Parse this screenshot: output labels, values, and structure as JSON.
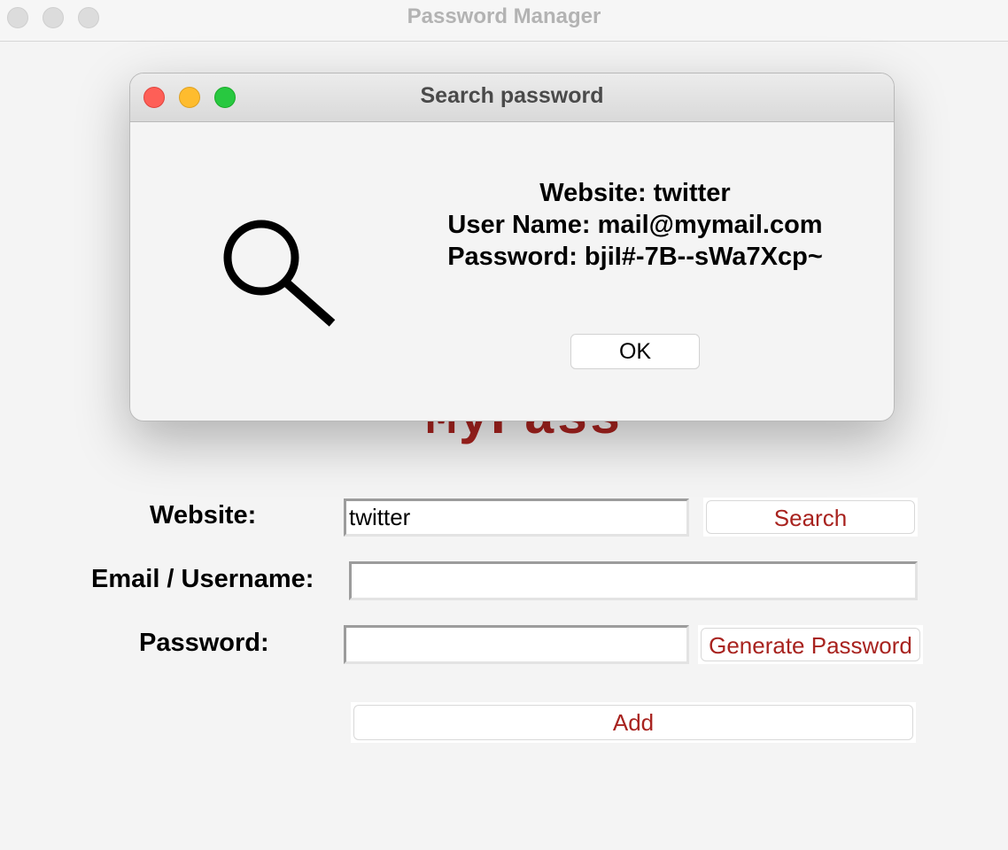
{
  "window": {
    "title": "Password Manager"
  },
  "logo": {
    "text": "MyPass",
    "color": "#a8231f"
  },
  "form": {
    "website_label": "Website:",
    "website_value": "twitter",
    "email_label": "Email / Username:",
    "email_value": "",
    "password_label": "Password:",
    "password_value": "",
    "search_label": "Search",
    "generate_label": "Generate Password",
    "add_label": "Add"
  },
  "dialog": {
    "title": "Search password",
    "icon": "search-icon",
    "line1": "Website: twitter",
    "line2": "User Name: mail@mymail.com",
    "line3": "Password: bjiI#-7B--sWa7Xcp~",
    "ok_label": "OK"
  },
  "colors": {
    "accent": "#a8231f",
    "traffic_red": "#fe5f57",
    "traffic_yellow": "#febc2e",
    "traffic_green": "#28c840"
  }
}
